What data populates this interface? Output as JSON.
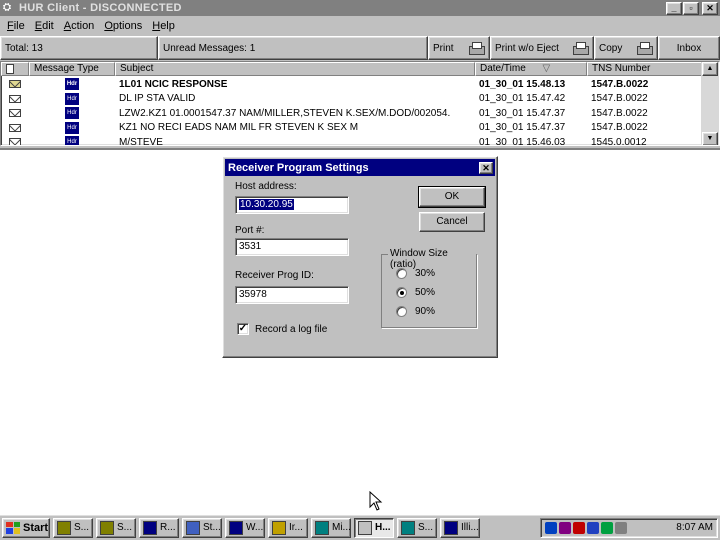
{
  "window": {
    "title": "HUR Client - DISCONNECTED"
  },
  "menu": {
    "items": [
      {
        "underline": "F",
        "rest": "ile"
      },
      {
        "underline": "E",
        "rest": "dit"
      },
      {
        "underline": "A",
        "rest": "ction"
      },
      {
        "underline": "O",
        "rest": "ptions"
      },
      {
        "underline": "H",
        "rest": "elp"
      }
    ]
  },
  "toolbar": {
    "total": "Total:  13",
    "unread": "Unread Messages:  1",
    "print": "Print",
    "print_eject": "Print w/o Eject",
    "copy": "Copy",
    "inbox": "Inbox"
  },
  "list": {
    "headers": {
      "type": "Message Type",
      "subject": "Subject",
      "date": "Date/Time",
      "sort_indicator": "▽",
      "tns": "TNS Number"
    },
    "rows": [
      {
        "subject": "1L01 NCIC RESPONSE",
        "date": "01_30_01 15.48.13",
        "tns": "1547.B.0022",
        "unread": true,
        "badge": "Hdr"
      },
      {
        "subject": "DL  IP STA  VALID",
        "date": "01_30_01 15.47.42",
        "tns": "1547.B.0022",
        "unread": false,
        "badge": "Hdr"
      },
      {
        "subject": "LZW2.KZ1 01.0001547.37 NAM/MILLER,STEVEN K.SEX/M.DOD/002054.",
        "date": "01_30_01 15.47.37",
        "tns": "1547.B.0022",
        "unread": false,
        "badge": "Hdr"
      },
      {
        "subject": "KZ1 NO RECI EADS NAM MIL FR STEVEN K SEX M",
        "date": "01_30_01 15.47.37",
        "tns": "1547.B.0022",
        "unread": false,
        "badge": "Hdr"
      },
      {
        "subject": "M/STEVE",
        "date": "01_30_01 15.46.03",
        "tns": "1545.0.0012",
        "unread": false,
        "badge": "Hdr"
      }
    ]
  },
  "dialog": {
    "title": "Receiver Program Settings",
    "host_label": "Host address:",
    "host_value": "10.30.20.95",
    "port_label": "Port #:",
    "port_value": "3531",
    "prog_label": "Receiver Prog ID:",
    "prog_value": "35978",
    "ok_label": "OK",
    "cancel_label": "Cancel",
    "window_size_label": "Window Size (ratio)",
    "options": [
      "30%",
      "50%",
      "90%"
    ],
    "selected_option": "50%",
    "log_label": "Record a log file",
    "log_checked": true
  },
  "taskbar": {
    "start_label": "Start",
    "tasks": [
      {
        "label": "S...",
        "icon_color": "#808000",
        "active": false
      },
      {
        "label": "S...",
        "icon_color": "#808000",
        "active": false
      },
      {
        "label": "R...",
        "icon_color": "#000080",
        "active": false
      },
      {
        "label": "St...",
        "icon_color": "#4060c0",
        "active": false
      },
      {
        "label": "W...",
        "icon_color": "#000080",
        "active": false
      },
      {
        "label": "Ir...",
        "icon_color": "#c0a000",
        "active": false
      },
      {
        "label": "Mi...",
        "icon_color": "#008080",
        "active": false
      },
      {
        "label": "H...",
        "icon_color": "#c0c0c0",
        "active": true
      },
      {
        "label": "S...",
        "icon_color": "#008080",
        "active": false
      },
      {
        "label": "Illi...",
        "icon_color": "#000080",
        "active": false
      }
    ],
    "tray_icon_colors": [
      "#0040c0",
      "#800080",
      "#c00000",
      "#2040c0",
      "#00a040",
      "#808080"
    ],
    "clock": "8:07 AM"
  }
}
